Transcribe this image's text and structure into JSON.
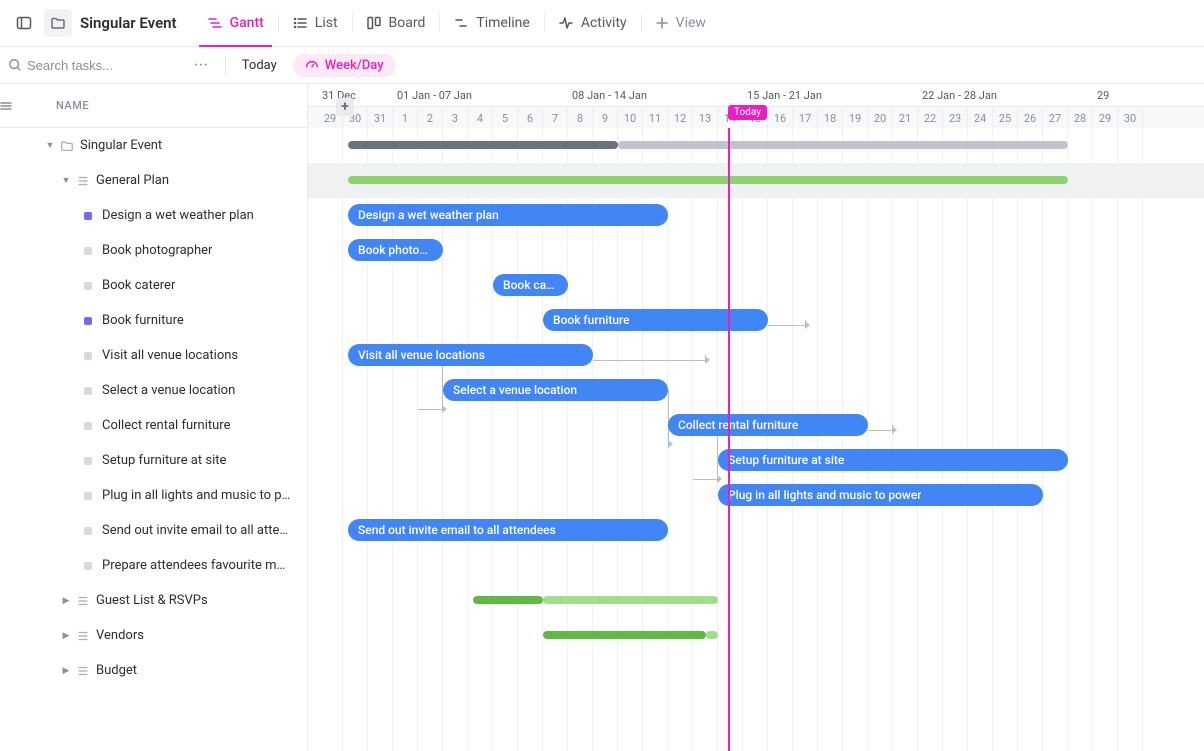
{
  "project": {
    "name": "Singular Event"
  },
  "views": {
    "gantt": "Gantt",
    "list": "List",
    "board": "Board",
    "timeline": "Timeline",
    "activity": "Activity",
    "add": "View"
  },
  "subbar": {
    "search_placeholder": "Search tasks...",
    "today": "Today",
    "zoom": "Week/Day"
  },
  "tree": {
    "name_header": "NAME",
    "root": "Singular Event",
    "groups": {
      "general": "General Plan",
      "guest": "Guest List & RSVPs",
      "vendors": "Vendors",
      "budget": "Budget"
    },
    "tasks": [
      {
        "label": "Design a wet weather plan",
        "color": "purple"
      },
      {
        "label": "Book photographer",
        "color": "grey"
      },
      {
        "label": "Book caterer",
        "color": "grey"
      },
      {
        "label": "Book furniture",
        "color": "purple"
      },
      {
        "label": "Visit all venue locations",
        "color": "grey"
      },
      {
        "label": "Select a venue location",
        "color": "grey"
      },
      {
        "label": "Collect rental furniture",
        "color": "grey"
      },
      {
        "label": "Setup furniture at site",
        "color": "grey"
      },
      {
        "label": "Plug in all lights and music to power",
        "color": "grey"
      },
      {
        "label": "Send out invite email to all attendees",
        "color": "grey"
      },
      {
        "label": "Prepare attendees favourite music playlist",
        "color": "grey"
      }
    ]
  },
  "timeline": {
    "today_label": "Today",
    "weeks": [
      {
        "label": "31 Dec",
        "start_day_index": 0
      },
      {
        "label": "01 Jan - 07 Jan",
        "start_day_index": 3
      },
      {
        "label": "08 Jan - 14 Jan",
        "start_day_index": 10
      },
      {
        "label": "15 Jan - 21 Jan",
        "start_day_index": 17
      },
      {
        "label": "22 Jan - 28 Jan",
        "start_day_index": 24
      },
      {
        "label": "29",
        "start_day_index": 31
      }
    ],
    "days": [
      "29",
      "30",
      "31",
      "1",
      "2",
      "3",
      "4",
      "5",
      "6",
      "7",
      "8",
      "9",
      "10",
      "11",
      "12",
      "13",
      "14",
      "15",
      "16",
      "17",
      "18",
      "19",
      "20",
      "21",
      "22",
      "23",
      "24",
      "25",
      "26",
      "27",
      "28",
      "29",
      "30"
    ],
    "today_index": 16.4
  },
  "bars": {
    "root_summary": {
      "start": 1.2,
      "end": 30,
      "segments": [
        {
          "from": 1.2,
          "to": 12,
          "color": "#6b7280"
        },
        {
          "from": 12,
          "to": 30,
          "color": "#c0c4cc"
        }
      ]
    },
    "general_summary": {
      "start": 1.2,
      "end": 30,
      "color": "#8ed26f"
    },
    "tasks": [
      {
        "row": 2,
        "label": "Design a wet weather plan",
        "start": 1.2,
        "end": 14
      },
      {
        "row": 3,
        "label": "Book photograp...",
        "start": 1.2,
        "end": 5
      },
      {
        "row": 4,
        "label": "Book caterer",
        "start": 7,
        "end": 10
      },
      {
        "row": 5,
        "label": "Book furniture",
        "start": 9,
        "end": 18
      },
      {
        "row": 6,
        "label": "Visit all venue locations",
        "start": 1.2,
        "end": 11
      },
      {
        "row": 7,
        "label": "Select a venue location",
        "start": 5,
        "end": 14
      },
      {
        "row": 8,
        "label": "Collect rental furniture",
        "start": 14,
        "end": 22
      },
      {
        "row": 9,
        "label": "Setup furniture at site",
        "start": 16,
        "end": 30
      },
      {
        "row": 10,
        "label": "Plug in all lights and music to power",
        "start": 16,
        "end": 29
      },
      {
        "row": 11,
        "label": "Send out invite email to all attendees",
        "start": 1.2,
        "end": 14
      }
    ],
    "deps": [
      {
        "fromRow": 5,
        "fromX": 18,
        "toRow": 5,
        "toX": 19.5,
        "drop": 4
      },
      {
        "fromRow": 6,
        "fromX": 11,
        "toRow": 6,
        "toX": 15.5,
        "drop": 4
      },
      {
        "fromRow": 6,
        "fromX": 4,
        "toRow": 7,
        "toX": 5,
        "drop": 20
      },
      {
        "fromRow": 7,
        "fromX": 14,
        "toRow": 8,
        "toX": 14,
        "drop": 20
      },
      {
        "fromRow": 8,
        "fromX": 22,
        "toRow": 8,
        "toX": 23,
        "drop": 4
      },
      {
        "fromRow": 8,
        "fromX": 15,
        "toRow": 9,
        "toX": 16,
        "drop": 20
      }
    ],
    "guest_summary": {
      "start": 6.2,
      "end": 16,
      "segments": [
        {
          "from": 6.2,
          "to": 9,
          "color": "#5fb944"
        },
        {
          "from": 9,
          "to": 16,
          "color": "#a1dd8a"
        }
      ]
    },
    "vendors_summary": {
      "start": 9,
      "end": 16,
      "segments": [
        {
          "from": 9,
          "to": 15.5,
          "color": "#5fb944"
        },
        {
          "from": 15.5,
          "to": 16,
          "color": "#a1dd8a"
        }
      ]
    }
  }
}
